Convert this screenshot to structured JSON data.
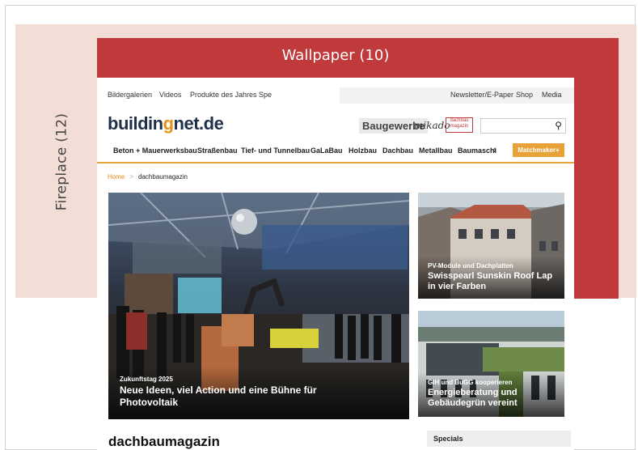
{
  "ads": {
    "fireplace_label": "Fireplace (12)",
    "wallpaper_label": "Wallpaper (10)"
  },
  "topnav": {
    "left": [
      "Bildergalerien",
      "Videos",
      "Produkte des Jahres",
      "Spe"
    ],
    "right": [
      "Newsletter/E-Paper",
      "Shop",
      "Media"
    ]
  },
  "header": {
    "logo_pre": "buildin",
    "logo_dot": "g",
    "logo_post": "net.de",
    "brand_baugewerbe": "Baugewerbe",
    "brand_mikado": "mikado",
    "brand_dachbau": "dachbau magazin",
    "search_placeholder": "",
    "search_icon": "search-icon"
  },
  "mainnav": {
    "items": [
      "Beton + Mauerwerksbau",
      "Straßenbau",
      "Tief- und Tunnelbau",
      "GaLaBau",
      "Holzbau",
      "Dachbau",
      "Metallbau",
      "Baumaschi"
    ],
    "more_icon": "chevron-right-icon",
    "cta": "Matchmaker+"
  },
  "breadcrumb": {
    "home": "Home",
    "separator": ">",
    "current": "dachbaumagazin"
  },
  "hero": {
    "kicker": "Zukunftstag 2025",
    "title": "Neue Ideen, viel Action und eine Bühne für Photovoltaik"
  },
  "cards": [
    {
      "kicker": "PV-Module und Dachplatten",
      "title": "Swisspearl Sunskin Roof Lap in vier Farben"
    },
    {
      "kicker": "GIH und BuGG kooperieren",
      "title": "Energieberatung und Gebäudegrün vereint"
    }
  ],
  "page_title": "dachbaumagazin",
  "sidebar": {
    "specials": "Specials"
  },
  "colors": {
    "accent": "#e8a23a",
    "wallpaper": "#c0393b",
    "fireplace": "#f2ddd7",
    "logo": "#1f3047"
  }
}
